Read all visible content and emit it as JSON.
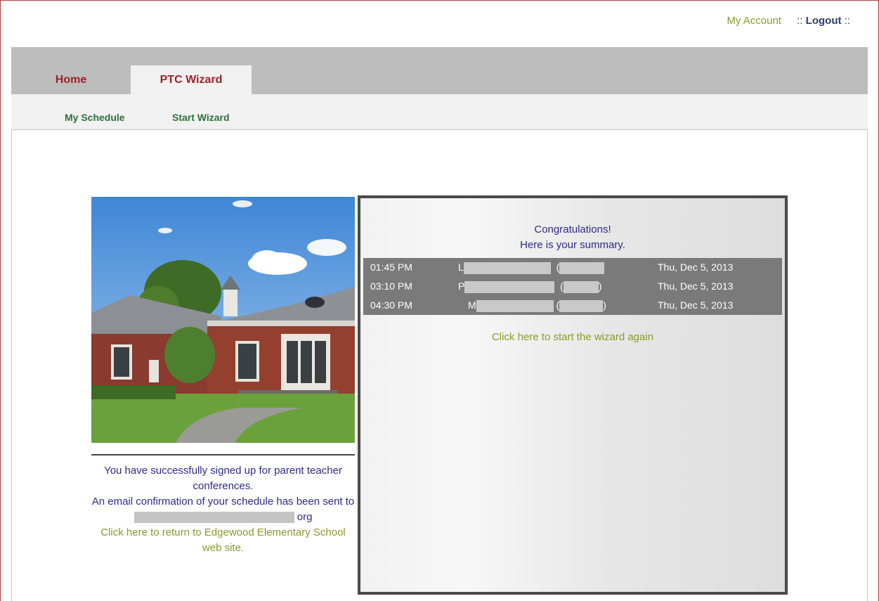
{
  "header": {
    "my_account": "My Account",
    "logout": ":: Logout ::",
    "logout_prefix": "::",
    "logout_label": "Logout",
    "logout_suffix": "::"
  },
  "tabs": [
    {
      "label": "Home",
      "active": false
    },
    {
      "label": "PTC Wizard",
      "active": true
    }
  ],
  "subnav": {
    "my_schedule": "My Schedule",
    "start_wizard": "Start Wizard"
  },
  "confirmation": {
    "line1": "You have successfully signed up for parent teacher conferences.",
    "line2": "An email confirmation of your schedule has been sent to",
    "email_suffix": "org",
    "return_link": "Click here to return to Edgewood Elementary School web site."
  },
  "summary": {
    "title": "Congratulations!",
    "subtitle": "Here is your summary.",
    "appointments": [
      {
        "time": "01:45 PM",
        "name_initial": "L",
        "date": "Thu, Dec 5, 2013"
      },
      {
        "time": "03:10 PM",
        "name_initial": "P",
        "date": "Thu, Dec 5, 2013"
      },
      {
        "time": "04:30 PM",
        "name_initial": "M",
        "date": "Thu, Dec 5, 2013"
      }
    ],
    "restart_link": "Click here to start the wizard again"
  },
  "colors": {
    "tab_text": "#a0202a",
    "subnav_text": "#2f6f3a",
    "body_text": "#2c2a8a",
    "link_text": "#8a9a2a",
    "table_bg": "#7a7a7a"
  }
}
